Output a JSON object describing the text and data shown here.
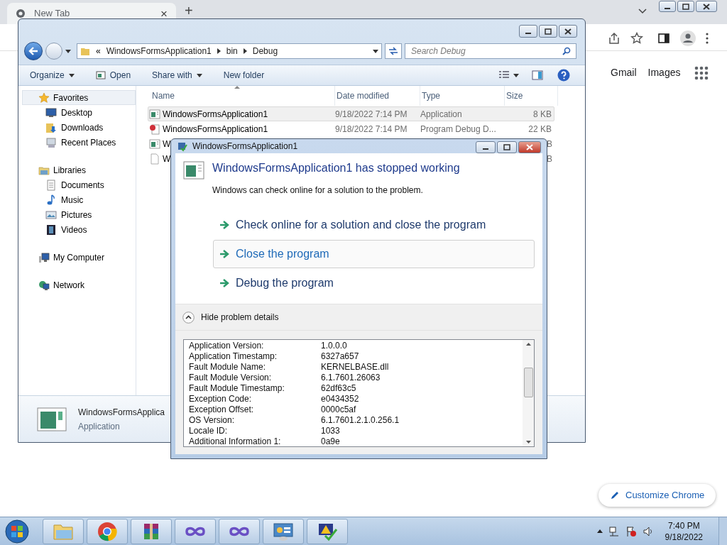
{
  "browser": {
    "tab": {
      "title": "New Tab",
      "close": "×",
      "new": "+"
    },
    "links": [
      "Gmail",
      "Images"
    ],
    "customize_button": "Customize Chrome"
  },
  "explorer": {
    "breadcrumb": [
      "WindowsFormsApplication1",
      "bin",
      "Debug"
    ],
    "overflow": "«",
    "search": {
      "placeholder": "Search Debug"
    },
    "toolbar": [
      {
        "label": "Organize",
        "kind": "menu"
      },
      {
        "label": "Open",
        "kind": "icon"
      },
      {
        "label": "Share with",
        "kind": "menu"
      },
      {
        "label": "New folder",
        "kind": "plain"
      }
    ],
    "nav": [
      {
        "label": "Favorites",
        "kind": "star",
        "selected": true,
        "children": [
          {
            "label": "Desktop",
            "kind": "desktop",
            "selected": false
          },
          {
            "label": "Downloads",
            "kind": "downloads",
            "selected": false
          },
          {
            "label": "Recent Places",
            "kind": "recent",
            "selected": false
          }
        ]
      },
      {
        "label": "Libraries",
        "kind": "library",
        "selected": false,
        "children": [
          {
            "label": "Documents",
            "kind": "documents",
            "selected": false
          },
          {
            "label": "Music",
            "kind": "music",
            "selected": false
          },
          {
            "label": "Pictures",
            "kind": "pictures",
            "selected": false
          },
          {
            "label": "Videos",
            "kind": "videos",
            "selected": false
          }
        ]
      },
      {
        "label": "My Computer",
        "kind": "computer",
        "selected": false
      },
      {
        "label": "Network",
        "kind": "network",
        "selected": false
      }
    ],
    "columns": [
      "Name",
      "Date modified",
      "Type",
      "Size"
    ],
    "rows": [
      {
        "name": "WindowsFormsApplication1",
        "date": "9/18/2022 7:14 PM",
        "type": "Application",
        "size": "8 KB",
        "kind": "app",
        "selected": true
      },
      {
        "name": "WindowsFormsApplication1",
        "date": "9/18/2022 7:14 PM",
        "type": "Program Debug D...",
        "size": "22 KB",
        "kind": "pdb",
        "selected": false
      },
      {
        "name": "W",
        "size": "B",
        "kind": "app",
        "selected": false
      },
      {
        "name": "W",
        "size": "B",
        "kind": "file",
        "selected": false
      }
    ],
    "details": {
      "name": "WindowsFormsApplica",
      "type": "Application"
    }
  },
  "dialog": {
    "title": "WindowsFormsApplication1",
    "heading": "WindowsFormsApplication1 has stopped working",
    "message": "Windows can check online for a solution to the problem.",
    "options": [
      {
        "label": "Check online for a solution and close the program",
        "selected": false
      },
      {
        "label": "Close the program",
        "selected": true
      },
      {
        "label": "Debug the program",
        "selected": false
      }
    ],
    "toggle": {
      "label": "Hide problem details",
      "expanded": true
    },
    "details": [
      {
        "label": "Application Version:",
        "value": "1.0.0.0"
      },
      {
        "label": "Application Timestamp:",
        "value": "6327a657"
      },
      {
        "label": "Fault Module Name:",
        "value": "KERNELBASE.dll"
      },
      {
        "label": "Fault Module Version:",
        "value": "6.1.7601.26063"
      },
      {
        "label": "Fault Module Timestamp:",
        "value": "62df63c5"
      },
      {
        "label": "Exception Code:",
        "value": "e0434352"
      },
      {
        "label": "Exception Offset:",
        "value": "0000c5af"
      },
      {
        "label": "OS Version:",
        "value": "6.1.7601.2.1.0.256.1"
      },
      {
        "label": "Locale ID:",
        "value": "1033"
      },
      {
        "label": "Additional Information 1:",
        "value": "0a9e"
      }
    ]
  },
  "taskbar": {
    "apps": [
      {
        "kind": "folder"
      },
      {
        "kind": "chrome"
      },
      {
        "kind": "archive"
      },
      {
        "kind": "infinity"
      },
      {
        "kind": "infinity"
      },
      {
        "kind": "panel"
      },
      {
        "kind": "alert"
      }
    ],
    "clock": {
      "time": "7:40 PM",
      "date": "9/18/2022"
    }
  }
}
